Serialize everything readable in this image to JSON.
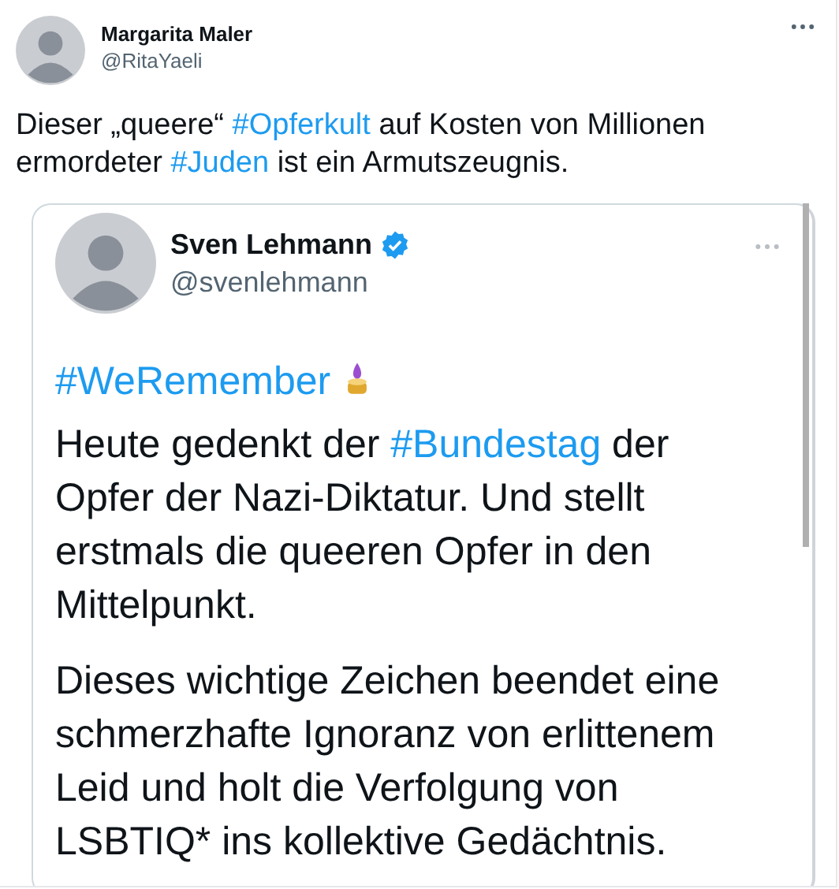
{
  "tweet": {
    "author": {
      "name": "Margarita Maler",
      "handle": "@RitaYaeli"
    },
    "text": [
      {
        "kind": "plain",
        "text": "Dieser „queere“ "
      },
      {
        "kind": "hashtag",
        "text": "#Opferkult"
      },
      {
        "kind": "plain",
        "text": " auf Kosten von Millionen ermordeter "
      },
      {
        "kind": "hashtag",
        "text": "#Juden"
      },
      {
        "kind": "plain",
        "text": " ist ein Armutszeugnis."
      }
    ],
    "quoted_image": {
      "author": {
        "name": "Sven Lehmann",
        "handle": "@svenlehmann",
        "verified": true
      },
      "paragraphs": [
        [
          {
            "kind": "hashtag",
            "text": "#WeRemember"
          },
          {
            "kind": "candle"
          }
        ],
        [
          {
            "kind": "plain",
            "text": "Heute gedenkt der "
          },
          {
            "kind": "hashtag",
            "text": "#Bundestag"
          },
          {
            "kind": "plain",
            "text": " der Opfer der Nazi-Diktatur. Und stellt erstmals die queeren Opfer in den Mittelpunkt."
          }
        ],
        [
          {
            "kind": "plain",
            "text": "Dieses wichtige Zeichen beendet eine schmerzhafte Ignoranz von erlittenem Leid und holt die Verfolgung von LSBTIQ* ins kollektive Gedächtnis."
          }
        ]
      ]
    }
  }
}
